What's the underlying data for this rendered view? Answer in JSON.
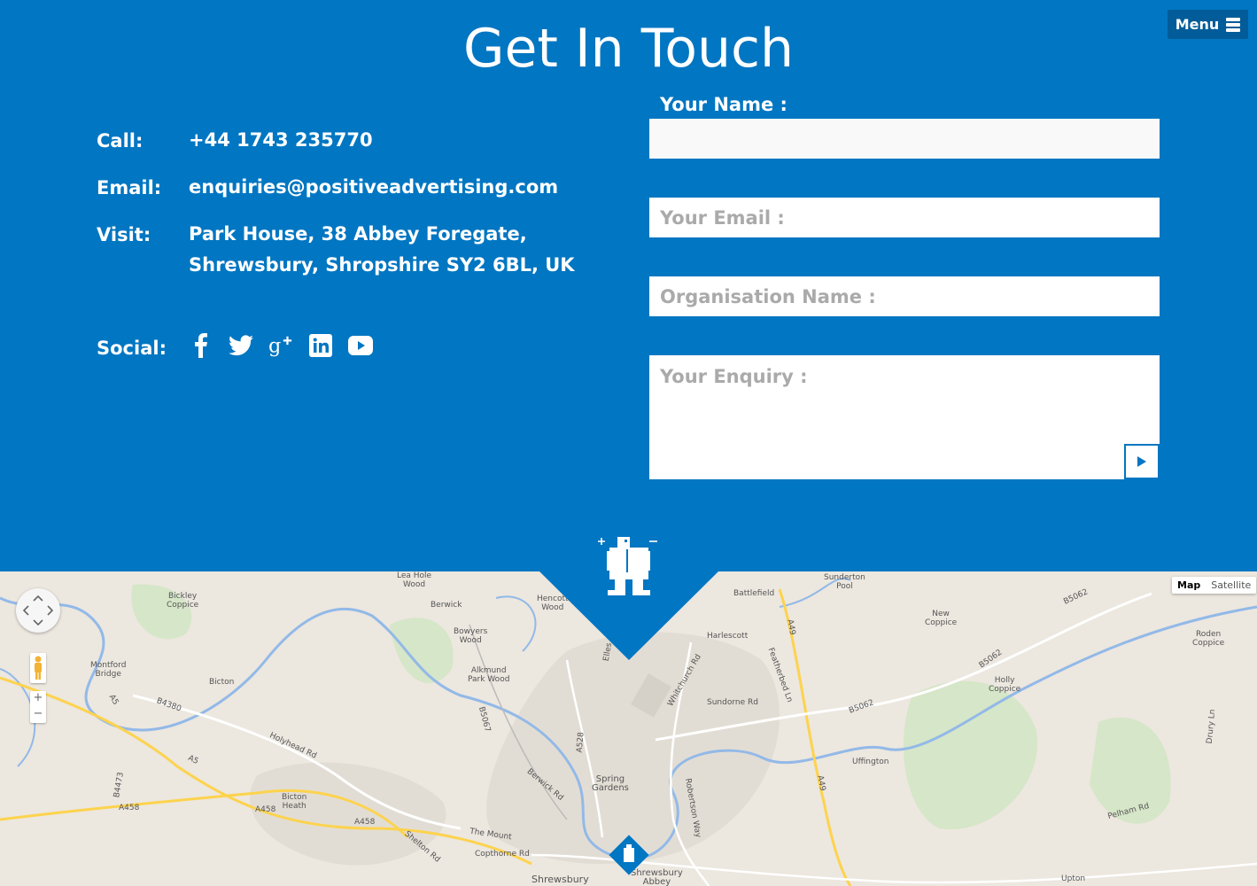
{
  "menu": {
    "label": "Menu"
  },
  "page": {
    "title": "Get In Touch"
  },
  "contact": {
    "call_label": "Call:",
    "call_value": "+44 1743 235770",
    "email_label": "Email:",
    "email_value": "enquiries@positiveadvertising.com",
    "visit_label": "Visit:",
    "visit_line1": "Park House, 38 Abbey Foregate,",
    "visit_line2": "Shrewsbury, Shropshire SY2 6BL, UK",
    "social_label": "Social:",
    "social_icons": [
      "facebook-icon",
      "twitter-icon",
      "google-plus-icon",
      "linkedin-icon",
      "youtube-icon"
    ]
  },
  "form": {
    "name_label": "Your Name :",
    "name_value": "",
    "email_placeholder": "Your Email :",
    "org_placeholder": "Organisation Name :",
    "enquiry_placeholder": "Your Enquiry :"
  },
  "map": {
    "type_map": "Map",
    "type_satellite": "Satellite",
    "zoom_in": "+",
    "zoom_out": "−",
    "labels": {
      "bickley": "Bickley\nCoppice",
      "berwick": "Berwick",
      "bowyers": "Bowyers\nWood",
      "alkmund": "Alkmund\nPark Wood",
      "montford": "Montford\nBridge",
      "bicton": "Bicton",
      "bicton_heath": "Bicton\nHeath",
      "b4380": "B4380",
      "holyhead": "Holyhead Rd",
      "a5": "A5",
      "a458": "A458",
      "b4473": "B4473",
      "the_mount": "The Mount",
      "copthorne": "Copthorne Rd",
      "shelton": "Shelton Rd",
      "berwick_rd": "Berwick Rd",
      "b5067": "B5067",
      "a528": "A528",
      "spring_gardens": "Spring\nGardens",
      "shrewsbury": "Shrewsbury",
      "shrewsbury_abbey": "Shrewsbury\nAbbey",
      "hencott": "Hencott\nWood",
      "battlefield": "Battlefield",
      "harlescott": "Harlescott",
      "whitchurch": "Whitchurch Rd",
      "sundorne": "Sundorne Rd",
      "featherbed": "Featherbed Ln",
      "robertson": "Robertson Way",
      "a49": "A49",
      "b5062": "B5062",
      "uffington": "Uffington",
      "new_coppice": "New\nCoppice",
      "holly_coppice": "Holly\nCoppice",
      "roden": "Roden\nCoppice",
      "sundorne_pool": "Sunderton\nPool",
      "pelham": "Pelham Rd",
      "upton": "Upton",
      "drury": "Drury Ln",
      "ellesmere": "Elles",
      "lea_hole": "Lea Hole\nWood"
    }
  },
  "colors": {
    "brand_blue": "#0176c2",
    "dark_blue": "#015c99"
  }
}
